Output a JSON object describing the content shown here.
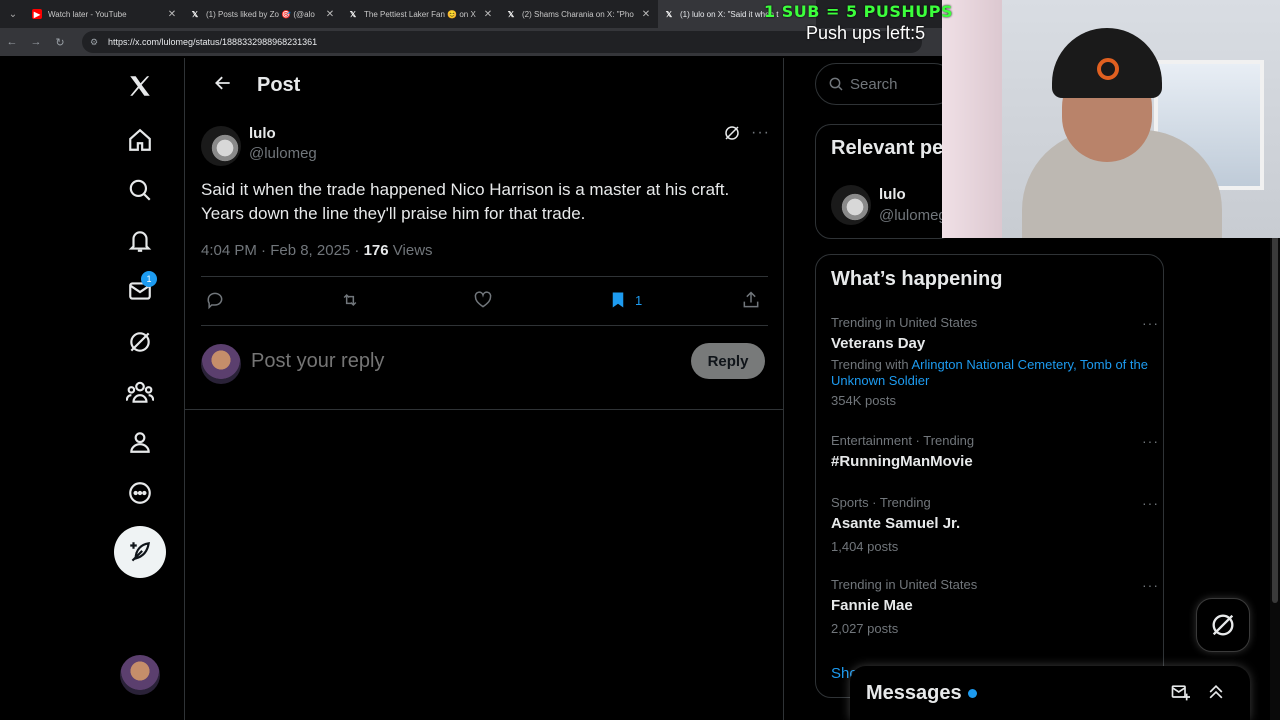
{
  "browser": {
    "tabs": [
      {
        "title": "Watch later - YouTube",
        "favicon": "youtube-icon",
        "active": false
      },
      {
        "title": "(1) Posts liked by Zo 🎯 (@alo",
        "favicon": "x-icon",
        "active": false
      },
      {
        "title": "The Pettiest Laker Fan 😊 on X",
        "favicon": "x-icon",
        "active": false
      },
      {
        "title": "(2) Shams Charania on X: \"Pho",
        "favicon": "x-icon",
        "active": false
      },
      {
        "title": "(1) lulo on X: \"Said it when t",
        "favicon": "x-icon",
        "active": true
      }
    ],
    "url": "https://x.com/lulomeg/status/1888332988968231361"
  },
  "leftnav": {
    "items": [
      "home-icon",
      "explore-icon",
      "notifications-icon",
      "messages-icon",
      "grok-icon",
      "communities-icon",
      "profile-icon",
      "more-icon"
    ],
    "messages_badge": "1"
  },
  "main": {
    "header_title": "Post",
    "tweet": {
      "name": "lulo",
      "handle": "@lulomeg",
      "text": "Said it when the trade happened Nico Harrison is a master at his craft. Years down the line they'll praise him for that trade.",
      "time": "4:04 PM · Feb 8, 2025 · ",
      "views_count": "176",
      "views_label": " Views",
      "bookmark_count": "1"
    },
    "reply": {
      "placeholder": "Post your reply",
      "button": "Reply"
    }
  },
  "right": {
    "search_placeholder": "Search",
    "relevant": {
      "title": "Relevant people",
      "name": "lulo",
      "handle": "@lulomeg"
    },
    "trending": {
      "title": "What’s happening",
      "items": [
        {
          "context": "Trending in United States",
          "name": "Veterans Day",
          "with_label": "Trending with ",
          "with_links": "Arlington National Cemetery, Tomb of the Unknown Soldier",
          "posts": "354K posts"
        },
        {
          "context": "Entertainment · Trending",
          "name": "#RunningManMovie"
        },
        {
          "context": "Sports · Trending",
          "name": "Asante Samuel Jr.",
          "posts": "1,404 posts"
        },
        {
          "context": "Trending in United States",
          "name": "Fannie Mae",
          "posts": "2,027 posts"
        }
      ],
      "show_more": "Show more"
    },
    "messages_title": "Messages"
  },
  "overlay": {
    "sub_text": "1 SUB = 5 PUSHUPS",
    "pushups_text": "Push ups left:5"
  },
  "colors": {
    "accent": "#1d9bf0",
    "background": "#000000",
    "text": "#e7e9ea",
    "muted": "#71767b",
    "border": "#2f3336"
  }
}
